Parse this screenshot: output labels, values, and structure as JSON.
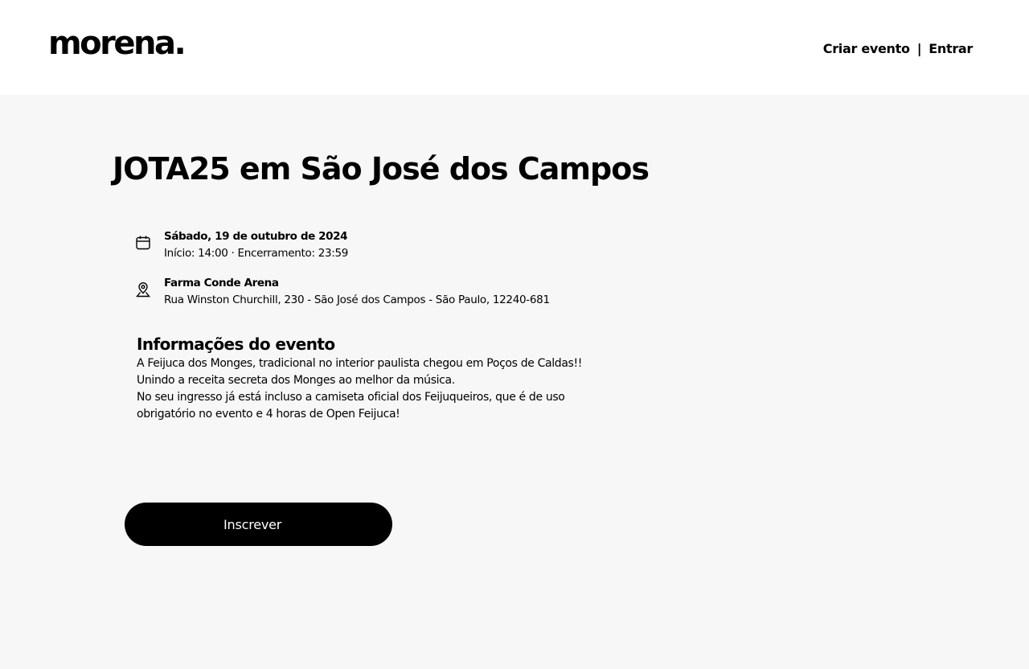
{
  "header": {
    "logo": "morena.",
    "nav": {
      "create_event": "Criar evento",
      "separator": "|",
      "login": "Entrar"
    }
  },
  "event": {
    "title": "JOTA25 em São José dos Campos",
    "date": {
      "icon": "calendar-icon",
      "day": "Sábado, 19 de outubro de 2024",
      "time": "Início: 14:00 · Encerramento: 23:59"
    },
    "location": {
      "icon": "map-pin-icon",
      "venue": "Farma Conde Arena",
      "address": "Rua Winston Churchill, 230 - São José dos Campos - São Paulo, 12240-681"
    },
    "about": {
      "heading": "Informações do evento",
      "lines": [
        "A Feijuca dos Monges, tradicional no interior paulista chegou em Poços de Caldas!!",
        "Unindo a receita secreta dos Monges ao melhor da música.",
        "No seu ingresso já está incluso a camiseta oficial dos Feijuqueiros, que é de uso obrigatório no evento e 4 horas de Open Feijuca!"
      ]
    },
    "register_label": "Inscrever"
  },
  "colors": {
    "header_bg": "#ffffff",
    "page_bg": "#f7f7f7",
    "primary": "#000000",
    "button_text": "#ffffff"
  }
}
